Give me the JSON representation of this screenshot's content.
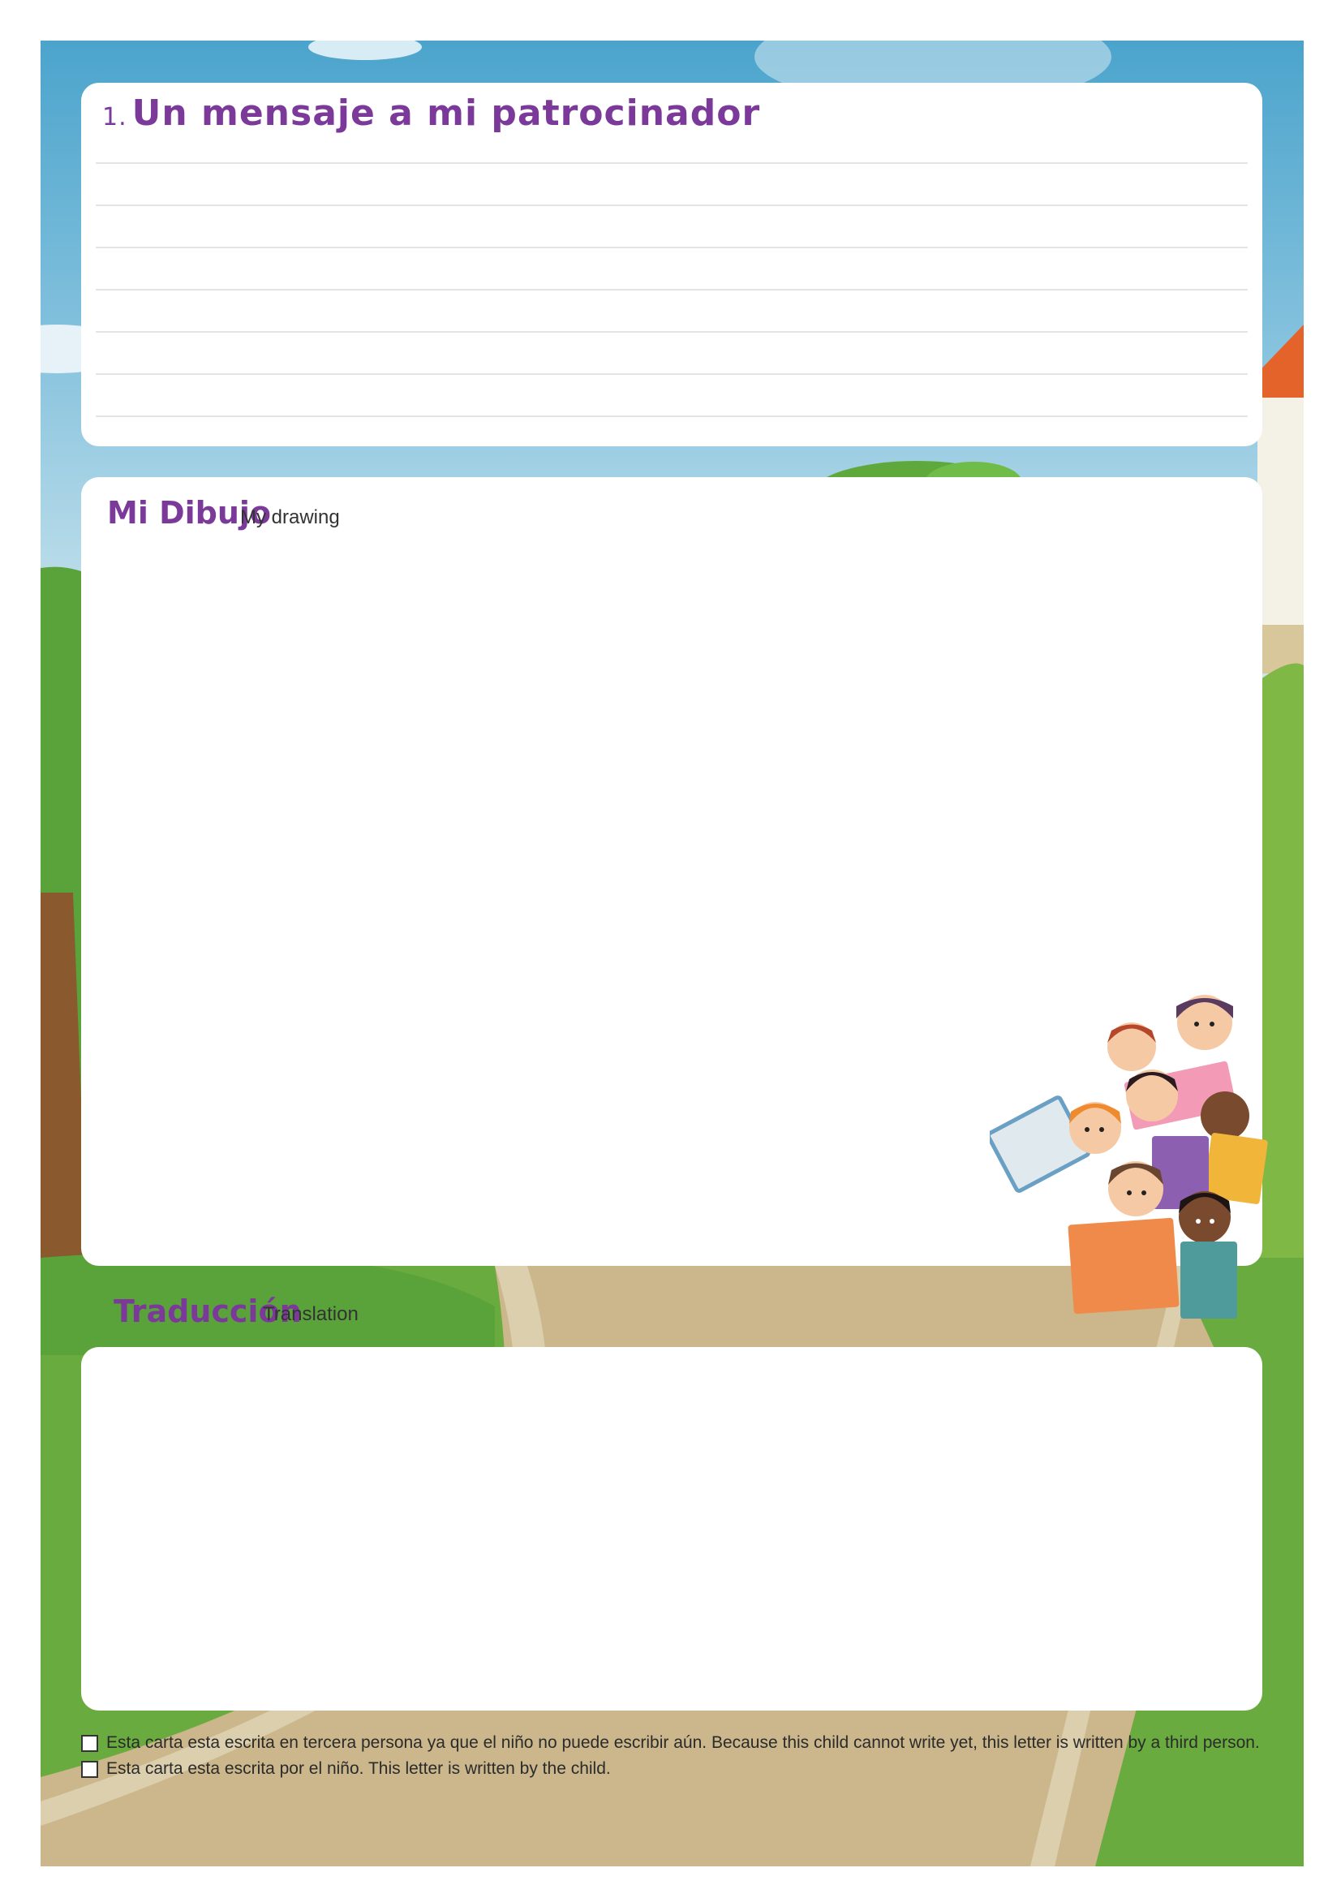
{
  "message_section": {
    "number": "1.",
    "title": "Un mensaje a mi patrocinador",
    "line_count": 7
  },
  "drawing_section": {
    "title": "Mi Dibujo",
    "subtitle": "My drawing"
  },
  "translation_section": {
    "title": "Traducción",
    "subtitle": "Translation"
  },
  "checkboxes": [
    {
      "label": "Esta carta esta escrita en tercera persona ya que el niño no puede escribir aún. Because this child cannot write yet, this letter is written by a third person.",
      "checked": false
    },
    {
      "label": "Esta carta esta escrita por el niño. This letter is written by the child.",
      "checked": false
    }
  ],
  "colors": {
    "title_purple": "#7b3a9a",
    "sky": "#7fbfdc",
    "grass": "#6aab3f",
    "path": "#cbb78b"
  }
}
